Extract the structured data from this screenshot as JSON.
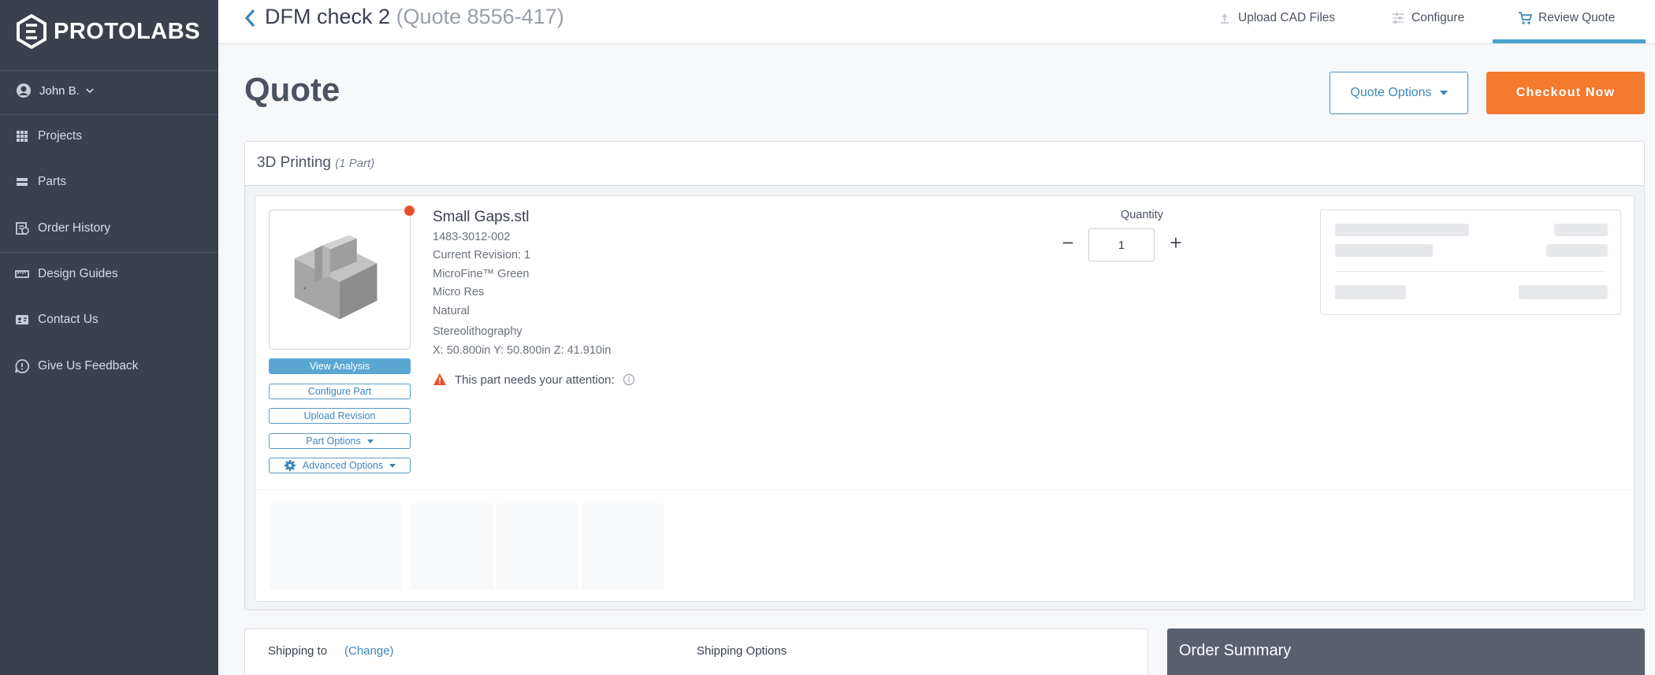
{
  "brand": {
    "name": "PROTOLABS"
  },
  "sidebar": {
    "user": "John B.",
    "items": [
      {
        "label": "Projects"
      },
      {
        "label": "Parts"
      },
      {
        "label": "Order History"
      },
      {
        "label": "Design Guides"
      },
      {
        "label": "Contact Us"
      },
      {
        "label": "Give Us Feedback"
      }
    ]
  },
  "header": {
    "title": "DFM check 2",
    "quote_ref": "(Quote 8556-417)",
    "tabs": [
      {
        "label": "Upload CAD Files",
        "icon": "upload-icon"
      },
      {
        "label": "Configure",
        "icon": "configure-icon"
      },
      {
        "label": "Review Quote",
        "icon": "cart-icon",
        "active": true
      }
    ]
  },
  "quote": {
    "title": "Quote",
    "options_label": "Quote Options",
    "checkout_label": "Checkout Now"
  },
  "section": {
    "title": "3D Printing",
    "count": "(1 Part)"
  },
  "part": {
    "name": "Small Gaps.stl",
    "number": "1483-3012-002",
    "revision": "Current Revision: 1",
    "material": "MicroFine™ Green",
    "resolution": "Micro Res",
    "finish": "Natural",
    "process": "Stereolithography",
    "dimensions": "X: 50.800in Y: 50.800in Z: 41.910in",
    "attention": "This part needs your attention:",
    "buttons": {
      "view_analysis": "View Analysis",
      "configure": "Configure Part",
      "upload_revision": "Upload Revision",
      "part_options": "Part Options",
      "advanced_options": "Advanced Options"
    },
    "quantity_label": "Quantity",
    "quantity": "1"
  },
  "shipping": {
    "label": "Shipping to",
    "change": "(Change)",
    "options_label": "Shipping Options"
  },
  "summary": {
    "title": "Order Summary"
  },
  "colors": {
    "sidebar": "#3b404f",
    "accent_blue": "#4aa3cf",
    "checkout": "#f47a2e",
    "alert": "#e8512a"
  }
}
